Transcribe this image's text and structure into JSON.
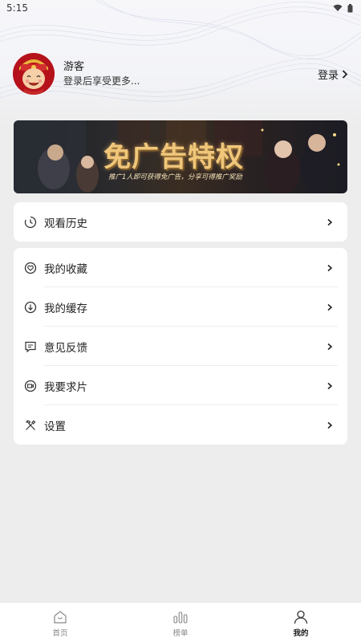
{
  "status_bar": {
    "time": "5:15"
  },
  "profile": {
    "name": "游客",
    "subtitle": "登录后享受更多...",
    "login_label": "登录"
  },
  "banner": {
    "title": "免广告特权",
    "subtitle": "推广1人即可获得免广告，分享可得推广奖励"
  },
  "history": {
    "label": "观看历史",
    "icon": "clock-icon"
  },
  "menu": [
    {
      "label": "我的收藏",
      "icon": "heart-icon"
    },
    {
      "label": "我的缓存",
      "icon": "download-icon"
    },
    {
      "label": "意见反馈",
      "icon": "message-icon"
    },
    {
      "label": "我要求片",
      "icon": "video-icon"
    },
    {
      "label": "设置",
      "icon": "tools-icon"
    }
  ],
  "tabbar": [
    {
      "label": "首页",
      "icon": "home-icon",
      "active": false
    },
    {
      "label": "榜单",
      "icon": "chart-icon",
      "active": false
    },
    {
      "label": "我的",
      "icon": "user-icon",
      "active": true
    }
  ],
  "colors": {
    "background": "#ededed",
    "card": "#ffffff",
    "banner_gold": "#f0c77a"
  }
}
